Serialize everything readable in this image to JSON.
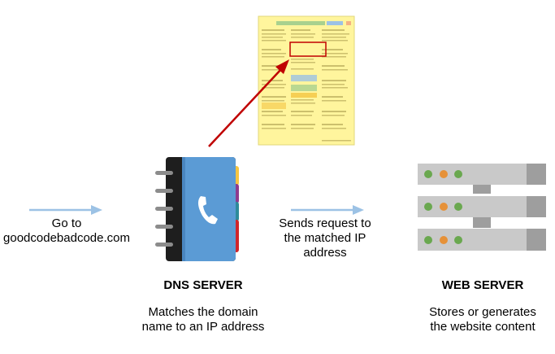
{
  "colors": {
    "arrow_blue": "#9cc2e5",
    "arrow_red": "#c00000",
    "book_blue": "#5b9bd5",
    "book_dark": "#1e1e1e",
    "tab_yellow": "#f4c542",
    "tab_purple": "#8e3b8e",
    "tab_teal": "#2e8b9a",
    "tab_red": "#d0262b",
    "server_grey": "#c9c9c9",
    "server_dark": "#9e9e9e",
    "led_green": "#6aa84f",
    "led_orange": "#e69138",
    "zone_yellow": "#fff59d"
  },
  "labels": {
    "client_line1": "Go to",
    "client_line2": "goodcodebadcode.com",
    "request_line1": "Sends request to",
    "request_line2": "the matched IP",
    "request_line3": "address",
    "dns_title": "DNS SERVER",
    "dns_desc_line1": "Matches the domain",
    "dns_desc_line2": "name to an IP address",
    "web_title": "WEB SERVER",
    "web_desc_line1": "Stores or generates",
    "web_desc_line2": "the website content"
  },
  "icons": [
    "phone-book-icon",
    "telephone-icon",
    "server-rack-icon",
    "zone-file-document-icon"
  ]
}
